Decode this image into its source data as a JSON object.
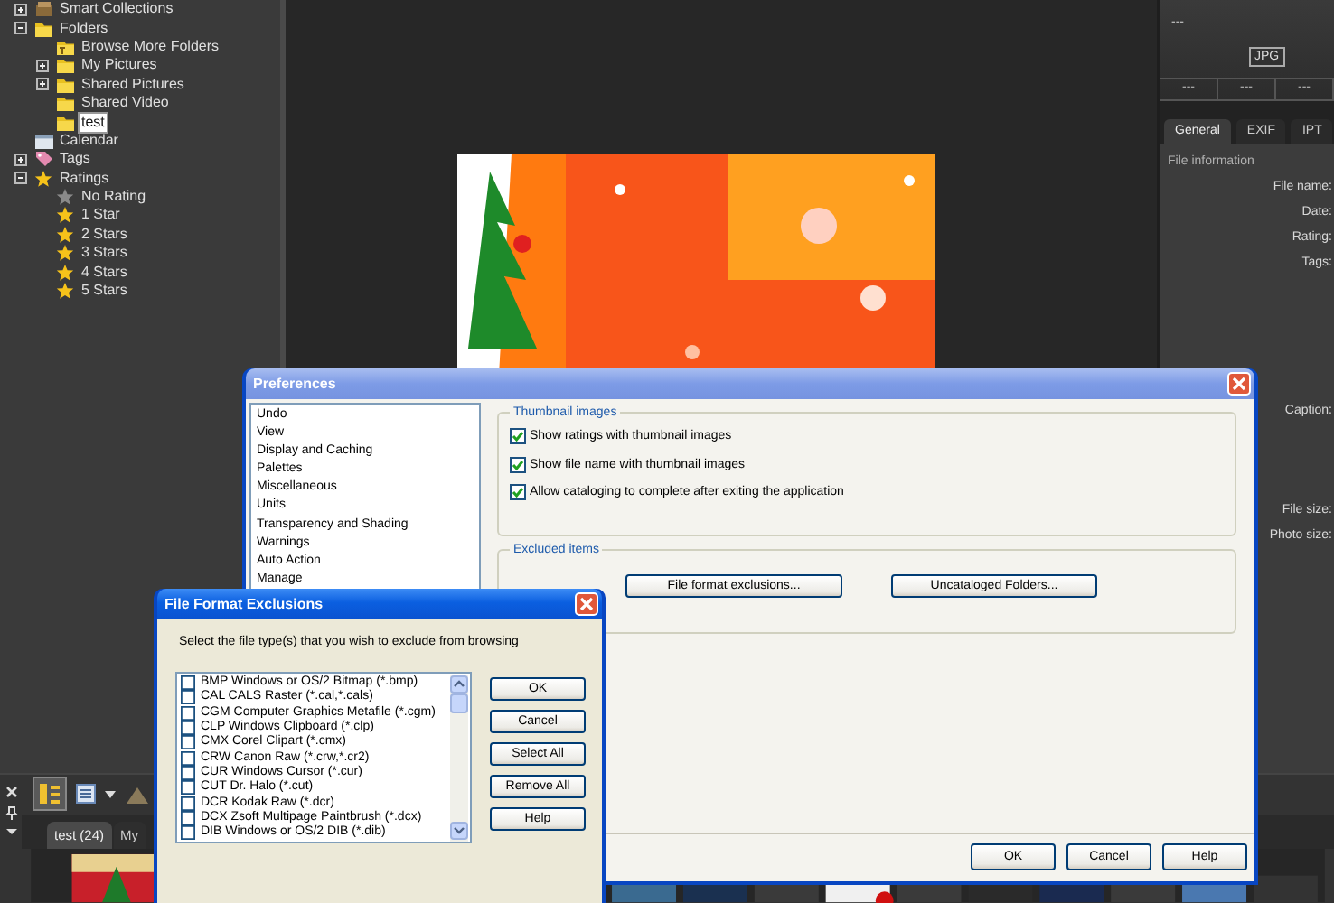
{
  "library_tree": {
    "items": [
      {
        "label": "Smart Collections",
        "kind": "collection",
        "expanded": false,
        "selected": false
      },
      {
        "label": "Folders",
        "kind": "folder",
        "expanded": true,
        "selected": false,
        "children": [
          {
            "label": "Browse More Folders",
            "kind": "browse",
            "selected": false
          },
          {
            "label": "My Pictures",
            "kind": "folder",
            "expanded": false,
            "selected": false
          },
          {
            "label": "Shared Pictures",
            "kind": "folder",
            "expanded": false,
            "selected": false
          },
          {
            "label": "Shared Video",
            "kind": "folder",
            "selected": false
          },
          {
            "label": "test",
            "kind": "folder",
            "selected": true
          }
        ]
      },
      {
        "label": "Calendar",
        "kind": "calendar",
        "selected": false
      },
      {
        "label": "Tags",
        "kind": "tag",
        "expanded": false,
        "selected": false
      },
      {
        "label": "Ratings",
        "kind": "rating",
        "expanded": true,
        "selected": false,
        "children": [
          {
            "label": "No Rating",
            "kind": "unrated",
            "selected": false
          },
          {
            "label": "1 Star",
            "kind": "rating",
            "selected": false
          },
          {
            "label": "2 Stars",
            "kind": "rating",
            "selected": false
          },
          {
            "label": "3 Stars",
            "kind": "rating",
            "selected": false
          },
          {
            "label": "4 Stars",
            "kind": "rating",
            "selected": false
          },
          {
            "label": "5 Stars",
            "kind": "rating",
            "selected": false
          }
        ]
      }
    ]
  },
  "info_panel": {
    "preview": {
      "name": "---",
      "format": "JPG",
      "fields": [
        "---",
        "---",
        "---"
      ]
    },
    "tabs": [
      {
        "label": "General",
        "selected": true
      },
      {
        "label": "EXIF",
        "selected": false
      },
      {
        "label": "IPT",
        "selected": false
      }
    ],
    "section": "File information",
    "fields": [
      {
        "label": "File name:",
        "kind": "line"
      },
      {
        "label": "Date:",
        "kind": "line"
      },
      {
        "label": "Rating:",
        "kind": "line"
      },
      {
        "label": "Tags:",
        "kind": "box"
      },
      {
        "label": "Caption:",
        "kind": "area"
      },
      {
        "label": "File size:",
        "kind": "line"
      },
      {
        "label": "Photo size:",
        "kind": "line"
      }
    ]
  },
  "browser": {
    "tabs": [
      {
        "label": "test (24)",
        "selected": true
      },
      {
        "label": "My",
        "selected": false
      }
    ]
  },
  "preferences": {
    "title": "Preferences",
    "categories": [
      {
        "label": "Undo",
        "selected": false
      },
      {
        "label": "View",
        "selected": false
      },
      {
        "label": "Display and Caching",
        "selected": false
      },
      {
        "label": "Palettes",
        "selected": false
      },
      {
        "label": "Miscellaneous",
        "selected": false
      },
      {
        "label": "Units",
        "selected": false
      },
      {
        "label": "Transparency and Shading",
        "selected": false
      },
      {
        "label": "Warnings",
        "selected": false
      },
      {
        "label": "Auto Action",
        "selected": false
      },
      {
        "label": "Manage",
        "selected": false
      }
    ],
    "thumbnail_group": {
      "title": "Thumbnail images",
      "options": [
        {
          "label": "Show ratings with thumbnail images",
          "checked": true
        },
        {
          "label": "Show file name with thumbnail images",
          "checked": true
        },
        {
          "label": "Allow cataloging to complete after exiting the application",
          "checked": true
        }
      ]
    },
    "excluded_group": {
      "title": "Excluded items",
      "buttons": [
        "File format exclusions...",
        "Uncataloged Folders..."
      ]
    },
    "buttons": [
      "OK",
      "Cancel",
      "Help"
    ]
  },
  "file_format_exclusions": {
    "title": "File Format Exclusions",
    "instruction": "Select the file type(s) that you wish to exclude from browsing",
    "formats": [
      {
        "label": "BMP Windows or OS/2 Bitmap (*.bmp)",
        "checked": false
      },
      {
        "label": "CAL CALS Raster (*.cal,*.cals)",
        "checked": false
      },
      {
        "label": "CGM Computer Graphics Metafile (*.cgm)",
        "checked": false
      },
      {
        "label": "CLP Windows Clipboard (*.clp)",
        "checked": false
      },
      {
        "label": "CMX Corel Clipart (*.cmx)",
        "checked": false
      },
      {
        "label": "CRW Canon Raw (*.crw,*.cr2)",
        "checked": false
      },
      {
        "label": "CUR Windows Cursor (*.cur)",
        "checked": false
      },
      {
        "label": "CUT Dr. Halo (*.cut)",
        "checked": false
      },
      {
        "label": "DCR Kodak Raw (*.dcr)",
        "checked": false
      },
      {
        "label": "DCX Zsoft Multipage Paintbrush (*.dcx)",
        "checked": false
      },
      {
        "label": "DIB Windows or OS/2 DIB (*.dib)",
        "checked": false
      }
    ],
    "buttons": [
      "OK",
      "Cancel",
      "Select All",
      "Remove All",
      "Help"
    ]
  }
}
